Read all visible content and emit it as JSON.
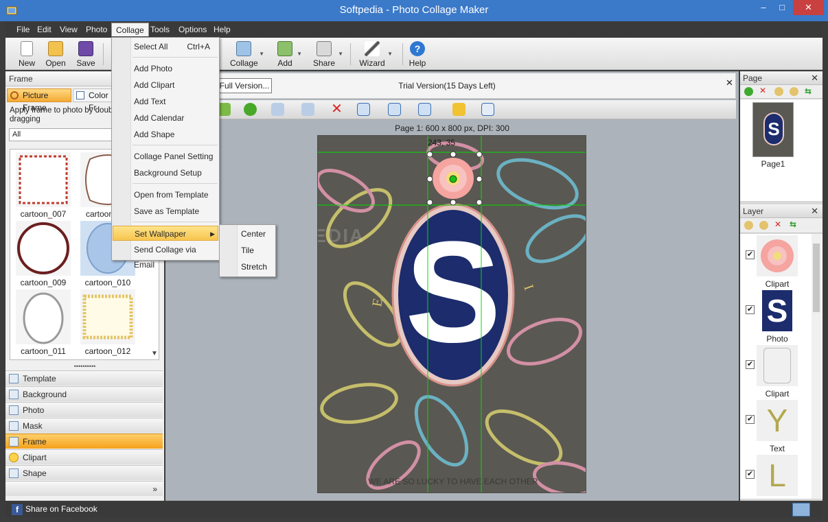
{
  "window": {
    "title": "Softpedia - Photo Collage Maker",
    "minimize": "–",
    "maximize": "□",
    "close": "✕"
  },
  "menu": [
    "File",
    "Edit",
    "View",
    "Photo",
    "Collage",
    "Tools",
    "Options",
    "Help"
  ],
  "toolbar": {
    "new": "New",
    "open": "Open",
    "save": "Save",
    "collage": "Collage",
    "add": "Add",
    "share": "Share",
    "wizard": "Wizard",
    "help": "Help"
  },
  "collage_menu": {
    "items": [
      {
        "label": "Select All",
        "shortcut": "Ctrl+A"
      },
      {
        "label": "Add Photo"
      },
      {
        "label": "Add Clipart"
      },
      {
        "label": "Add Text"
      },
      {
        "label": "Add Calendar"
      },
      {
        "label": "Add Shape"
      },
      {
        "label": "Collage Panel Setting"
      },
      {
        "label": "Background Setup"
      },
      {
        "label": "Open from Template"
      },
      {
        "label": "Save as Template"
      },
      {
        "label": "Set Wallpaper",
        "submenu": true
      },
      {
        "label": "Send Collage via Email"
      }
    ],
    "wallpaper_submenu": [
      "Center",
      "Tile",
      "Stretch"
    ]
  },
  "left_panel": {
    "header": "Frame",
    "tab_picture": "Picture Frame",
    "tab_color": "Color Fr",
    "instruction": "Apply frame to photo by double dragging",
    "filter": "All",
    "thumbs": [
      "cartoon_007",
      "cartoon",
      "cartoon_009",
      "cartoon_010",
      "cartoon_011",
      "cartoon_012"
    ],
    "nav": [
      "Template",
      "Background",
      "Photo",
      "Mask",
      "Frame",
      "Clipart",
      "Shape"
    ],
    "more": "»"
  },
  "share_facebook": "Share on Facebook",
  "center": {
    "full_version_btn": "Full Version...",
    "trial": "Trial Version(15 Days Left)",
    "close": "✕",
    "page_info": "Page 1: 600 x 800 px, DPI: 300",
    "coords": "243, 35",
    "canvas_caption": "WE ARE SO LUCKY TO HAVE EACH OTHER",
    "watermark": "SOFTPEDIA",
    "photo_letter": "S"
  },
  "right_panel": {
    "page_header": "Page",
    "page_label": "Page1",
    "layer_header": "Layer",
    "close": "✕",
    "layers": [
      {
        "name": "Clipart",
        "checked": true
      },
      {
        "name": "Photo",
        "checked": true
      },
      {
        "name": "Clipart",
        "checked": true
      },
      {
        "name": "Text",
        "checked": true,
        "glyph": "Y"
      },
      {
        "name": "",
        "checked": true,
        "glyph": "L"
      }
    ]
  },
  "colors": {
    "titlebar": "#3b79c9",
    "frame_active": "#f4a11c",
    "selection_guides": "#00e000"
  }
}
